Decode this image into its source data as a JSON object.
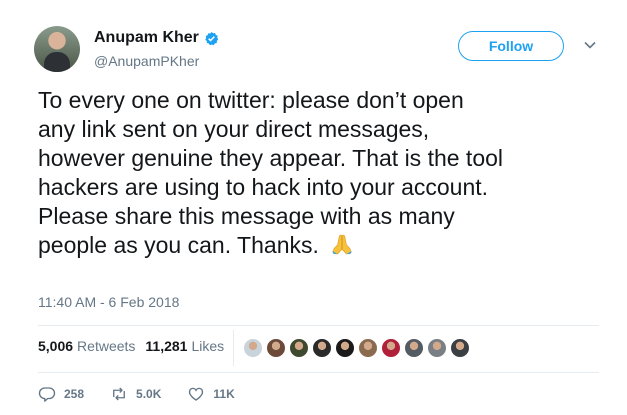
{
  "user": {
    "name": "Anupam Kher",
    "handle": "@AnupamPKher"
  },
  "follow_label": "Follow",
  "tweet": {
    "text": "To every one on twitter: please don’t open\nany link sent on your direct messages,\nhowever genuine they appear. That is the tool\nhackers are using to hack into your account.\nPlease share this message with as many\npeople as you can. Thanks. ",
    "emoji": "folded-hands-icon"
  },
  "timestamp": "11:40 AM - 6 Feb 2018",
  "stats": {
    "retweets_count": "5,006",
    "retweets_label": "Retweets",
    "likes_count": "11,281",
    "likes_label": "Likes"
  },
  "facepile_colors": [
    "#c9d3db",
    "#6b4a3a",
    "#3e4a2f",
    "#2a2a2a",
    "#1a1a1a",
    "#8a6b4f",
    "#b0203a",
    "#555b63",
    "#7a7f85",
    "#3a3f44"
  ],
  "actions": {
    "replies": "258",
    "retweets": "5.0K",
    "likes": "11K"
  },
  "colors": {
    "accent": "#1da1f2",
    "muted": "#657786"
  }
}
